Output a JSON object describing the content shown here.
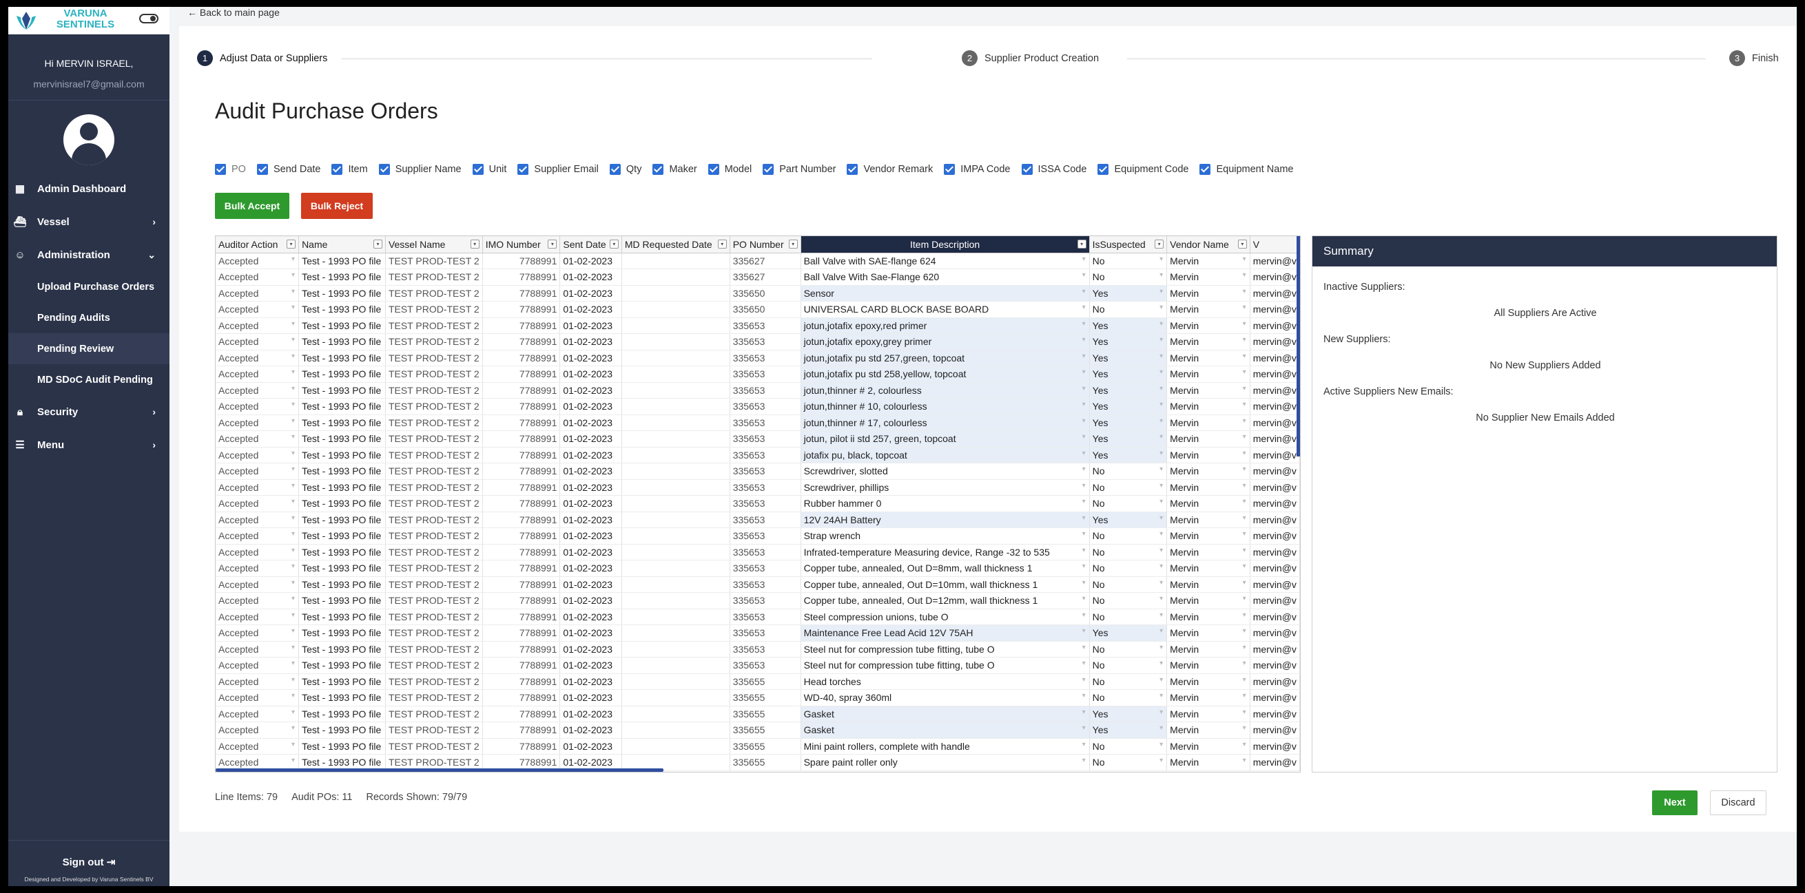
{
  "sidebar": {
    "brand": "VARUNA SENTINELS",
    "greeting": "Hi MERVIN ISRAEL,",
    "email": "mervinisrael7@gmail.com",
    "items": [
      {
        "label": "Admin Dashboard",
        "icon": "dashboard-icon"
      },
      {
        "label": "Vessel",
        "icon": "vessel-icon"
      },
      {
        "label": "Administration",
        "icon": "administration-icon"
      },
      {
        "label": "Security",
        "icon": "lock-icon"
      },
      {
        "label": "Menu",
        "icon": "menu-icon"
      }
    ],
    "subitems": [
      "Upload Purchase Orders",
      "Pending Audits",
      "Pending Review",
      "MD SDoC Audit Pending"
    ],
    "signout": "Sign out",
    "credit": "Designed and Developed by Varuna Sentinels BV"
  },
  "header": {
    "back": "Back to main page"
  },
  "stepper": [
    {
      "num": "1",
      "label": "Adjust Data or Suppliers"
    },
    {
      "num": "2",
      "label": "Supplier Product Creation"
    },
    {
      "num": "3",
      "label": "Finish"
    }
  ],
  "page_title": "Audit Purchase Orders",
  "column_toggles": [
    "PO",
    "Send Date",
    "Item",
    "Supplier Name",
    "Unit",
    "Supplier Email",
    "Qty",
    "Maker",
    "Model",
    "Part Number",
    "Vendor Remark",
    "IMPA Code",
    "ISSA Code",
    "Equipment Code",
    "Equipment Name"
  ],
  "buttons": {
    "bulk_accept": "Bulk Accept",
    "bulk_reject": "Bulk Reject",
    "next": "Next",
    "discard": "Discard"
  },
  "grid": {
    "headers": [
      "Auditor Action",
      "Name",
      "Vessel Name",
      "IMO Number",
      "Sent Date",
      "MD Requested Date",
      "PO Number",
      "Item Description",
      "IsSuspected",
      "Vendor Name",
      "V"
    ],
    "common": {
      "action": "Accepted",
      "name": "Test - 1993 PO file",
      "vessel": "TEST PROD-TEST 2",
      "imo": "7788991",
      "sent": "01-02-2023",
      "vendor": "Mervin",
      "email": "mervin@v"
    },
    "rows": [
      {
        "po": "335627",
        "desc": "Ball Valve with SAE-flange 624",
        "sus": "No"
      },
      {
        "po": "335627",
        "desc": "Ball Valve With Sae-Flange 620",
        "sus": "No"
      },
      {
        "po": "335650",
        "desc": "Sensor",
        "sus": "Yes"
      },
      {
        "po": "335650",
        "desc": "UNIVERSAL CARD BLOCK BASE BOARD",
        "sus": "No"
      },
      {
        "po": "335653",
        "desc": "jotun,jotafix epoxy,red primer",
        "sus": "Yes"
      },
      {
        "po": "335653",
        "desc": "jotun,jotafix epoxy,grey primer",
        "sus": "Yes"
      },
      {
        "po": "335653",
        "desc": "jotun,jotafix pu std 257,green, topcoat",
        "sus": "Yes"
      },
      {
        "po": "335653",
        "desc": "jotun,jotafix pu std 258,yellow, topcoat",
        "sus": "Yes"
      },
      {
        "po": "335653",
        "desc": "jotun,thinner # 2, colourless",
        "sus": "Yes"
      },
      {
        "po": "335653",
        "desc": "jotun,thinner # 10, colourless",
        "sus": "Yes"
      },
      {
        "po": "335653",
        "desc": "jotun,thinner # 17, colourless",
        "sus": "Yes"
      },
      {
        "po": "335653",
        "desc": "jotun, pilot ii std 257, green, topcoat",
        "sus": "Yes"
      },
      {
        "po": "335653",
        "desc": "jotafix pu, black, topcoat",
        "sus": "Yes"
      },
      {
        "po": "335653",
        "desc": "Screwdriver, slotted",
        "sus": "No"
      },
      {
        "po": "335653",
        "desc": "Screwdriver, phillips",
        "sus": "No"
      },
      {
        "po": "335653",
        "desc": "Rubber hammer 0",
        "sus": "No"
      },
      {
        "po": "335653",
        "desc": "12V 24AH Battery",
        "sus": "Yes"
      },
      {
        "po": "335653",
        "desc": "Strap wrench",
        "sus": "No"
      },
      {
        "po": "335653",
        "desc": "Infrated-temperature Measuring device, Range -32 to 535",
        "sus": "No"
      },
      {
        "po": "335653",
        "desc": "Copper tube, annealed, Out D=8mm, wall thickness 1",
        "sus": "No"
      },
      {
        "po": "335653",
        "desc": "Copper tube, annealed, Out D=10mm, wall thickness 1",
        "sus": "No"
      },
      {
        "po": "335653",
        "desc": "Copper tube, annealed, Out D=12mm, wall thickness 1",
        "sus": "No"
      },
      {
        "po": "335653",
        "desc": "Steel compression unions, tube O",
        "sus": "No"
      },
      {
        "po": "335653",
        "desc": "Maintenance Free Lead Acid 12V 75AH",
        "sus": "Yes"
      },
      {
        "po": "335653",
        "desc": "Steel nut for compression tube fitting, tube O",
        "sus": "No"
      },
      {
        "po": "335653",
        "desc": "Steel nut for compression tube fitting, tube O",
        "sus": "No"
      },
      {
        "po": "335655",
        "desc": "Head torches",
        "sus": "No"
      },
      {
        "po": "335655",
        "desc": "WD-40, spray 360ml",
        "sus": "No"
      },
      {
        "po": "335655",
        "desc": "Gasket",
        "sus": "Yes"
      },
      {
        "po": "335655",
        "desc": "Gasket",
        "sus": "Yes"
      },
      {
        "po": "335655",
        "desc": "Mini paint rollers, complete with handle",
        "sus": "No"
      },
      {
        "po": "335655",
        "desc": "Spare paint roller only",
        "sus": "No"
      }
    ]
  },
  "summary": {
    "title": "Summary",
    "inactive_label": "Inactive Suppliers:",
    "inactive_value": "All Suppliers Are Active",
    "new_label": "New Suppliers:",
    "new_value": "No New Suppliers Added",
    "emails_label": "Active Suppliers New Emails:",
    "emails_value": "No Supplier New Emails Added"
  },
  "footer": {
    "line_items": "Line Items: 79",
    "audit_pos": "Audit POs: 11",
    "records": "Records Shown: 79/79"
  }
}
